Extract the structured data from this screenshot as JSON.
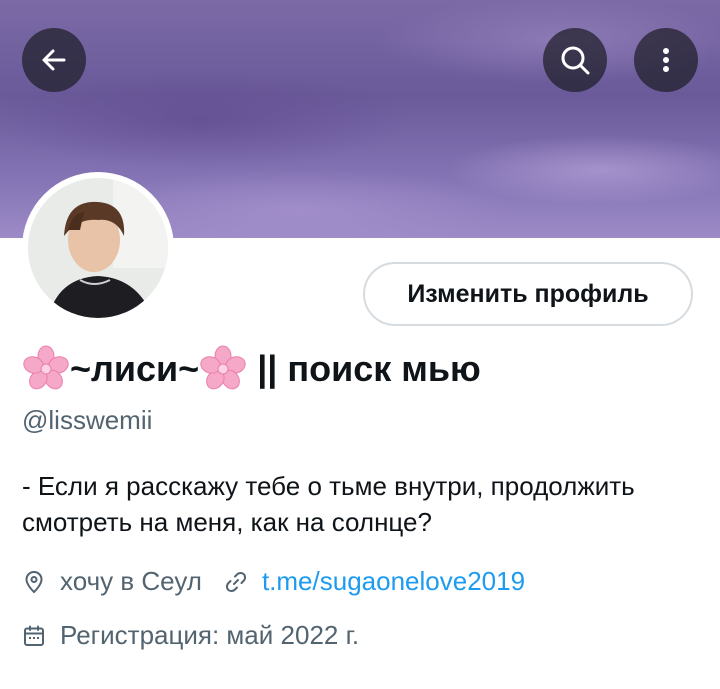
{
  "header": {
    "back_icon": "arrow-left-icon",
    "search_icon": "search-icon",
    "more_icon": "more-vertical-icon"
  },
  "profile": {
    "edit_button_label": "Изменить профиль",
    "name_part1": "~лиси~",
    "name_part2": " || поиск мью",
    "name_emoji": "sakura-flower-icon",
    "handle": "@lisswemii",
    "bio": "- Если я расскажу тебе о тьме внутри, продолжить смотреть на меня, как на солнце?",
    "location": "хочу в Сеул",
    "website": "t.me/sugaonelove2019",
    "joined": "Регистрация: май 2022 г."
  },
  "colors": {
    "text_primary": "#0f1419",
    "text_secondary": "#536471",
    "link": "#1d9bf0",
    "border": "#d6dbe0"
  }
}
